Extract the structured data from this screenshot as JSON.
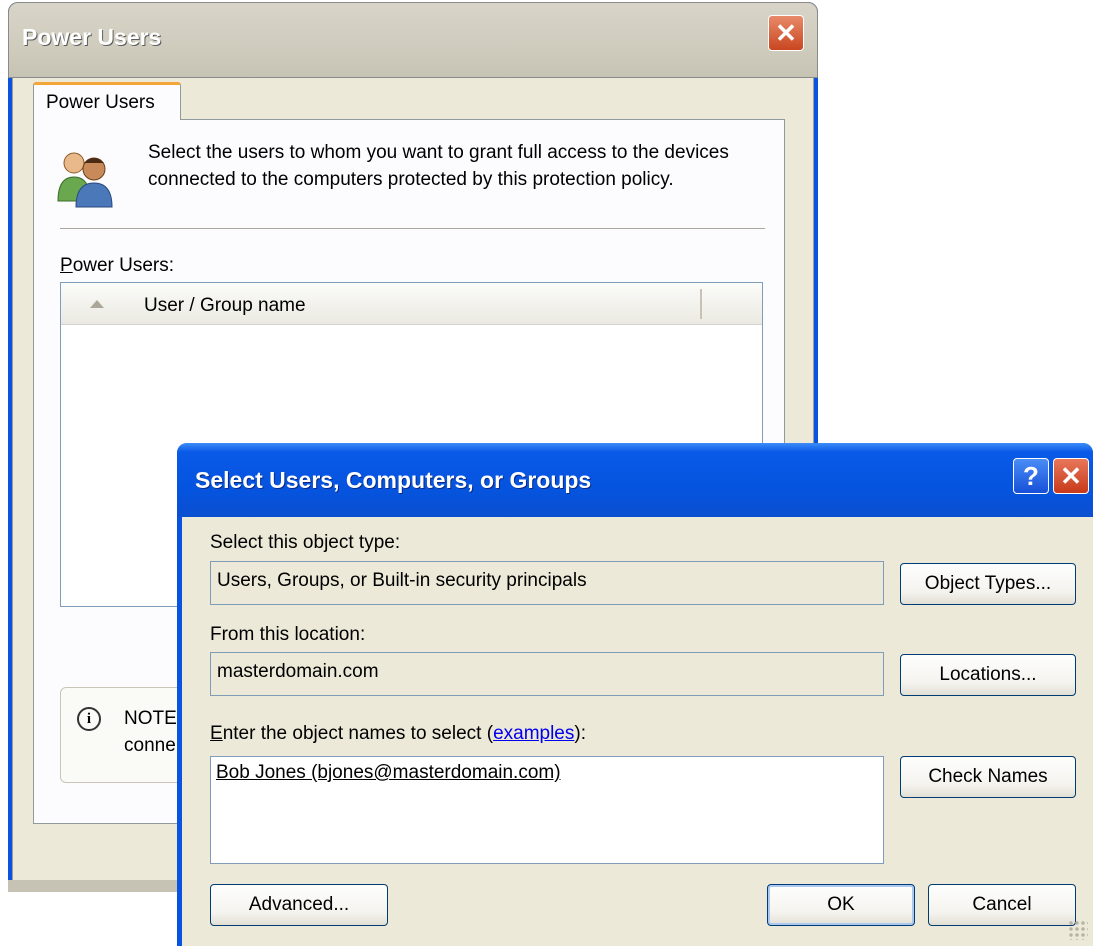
{
  "back_window": {
    "title": "Power Users",
    "close_label": "✕",
    "tab_label": "Power Users",
    "description": "Select the users to whom you want to grant full access to the devices connected to the computers protected by this protection policy.",
    "list_label_first": "P",
    "list_label_rest": "ower Users:",
    "list_column_header": "User / Group name",
    "note_line1": "NOTE",
    "note_line2": "conne"
  },
  "dialog": {
    "title": "Select Users, Computers, or Groups",
    "help_label": "?",
    "close_label": "✕",
    "object_type_label": "Select this object type:",
    "object_type_value": "Users, Groups, or Built-in security principals",
    "object_types_button": "Object Types...",
    "location_label": "From this location:",
    "location_value": "masterdomain.com",
    "locations_button": "Locations...",
    "names_label_first": "E",
    "names_label_rest": "nter the object names to select (",
    "names_label_link": "examples",
    "names_label_end": "):",
    "names_value": "Bob Jones (bjones@masterdomain.com)",
    "check_names_button": "Check Names",
    "advanced_button": "Advanced...",
    "ok_button": "OK",
    "cancel_button": "Cancel"
  },
  "icons": {
    "users_icon": "users-icon",
    "info_icon": "i",
    "sort_icon": "sort-ascending-icon"
  },
  "colors": {
    "dialog_titlebar": "#0554e0",
    "inactive_titlebar": "#cfccbe",
    "window_face": "#ece9d8",
    "link": "#0000ee"
  }
}
